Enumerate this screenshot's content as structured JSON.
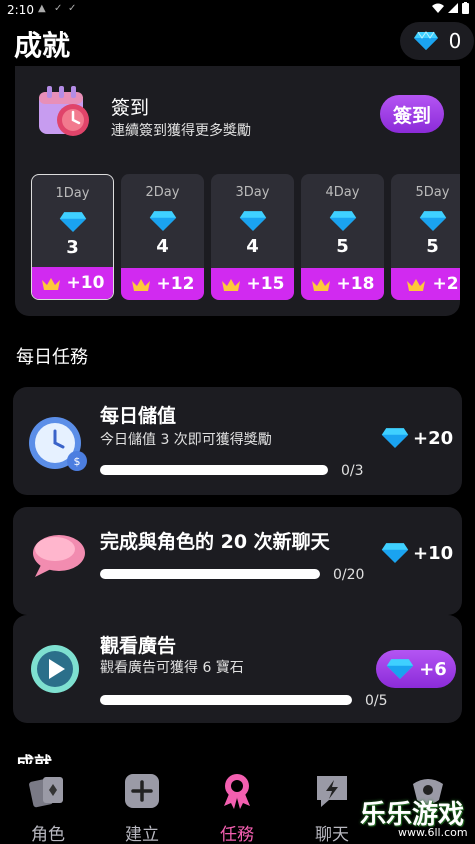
{
  "status": {
    "time": "2:10"
  },
  "header": {
    "title": "成就",
    "gem_count": "0"
  },
  "signin": {
    "title": "簽到",
    "subtitle": "連續簽到獲得更多獎勵",
    "button": "簽到",
    "days": [
      {
        "label": "1Day",
        "value": "3",
        "reward": "+10"
      },
      {
        "label": "2Day",
        "value": "4",
        "reward": "+12"
      },
      {
        "label": "3Day",
        "value": "4",
        "reward": "+15"
      },
      {
        "label": "4Day",
        "value": "5",
        "reward": "+18"
      },
      {
        "label": "5Day",
        "value": "5",
        "reward": "+2"
      }
    ]
  },
  "daily": {
    "title": "每日任務",
    "tasks": [
      {
        "title": "每日儲值",
        "subtitle": "今日儲值 3 次即可獲得獎勵",
        "progress": "0/3",
        "reward": "+20"
      },
      {
        "title": "完成與角色的 20 次新聊天",
        "progress": "0/20",
        "reward": "+10"
      },
      {
        "title": "觀看廣告",
        "subtitle": "觀看廣告可獲得 6 寶石",
        "progress": "0/5",
        "reward": "+6"
      }
    ]
  },
  "achievements": {
    "title": "成就"
  },
  "tabs": [
    {
      "label": "角色"
    },
    {
      "label": "建立"
    },
    {
      "label": "任務"
    },
    {
      "label": "聊天"
    }
  ],
  "watermark": {
    "text": "乐乐游戏",
    "url": "www.6ll.com"
  }
}
